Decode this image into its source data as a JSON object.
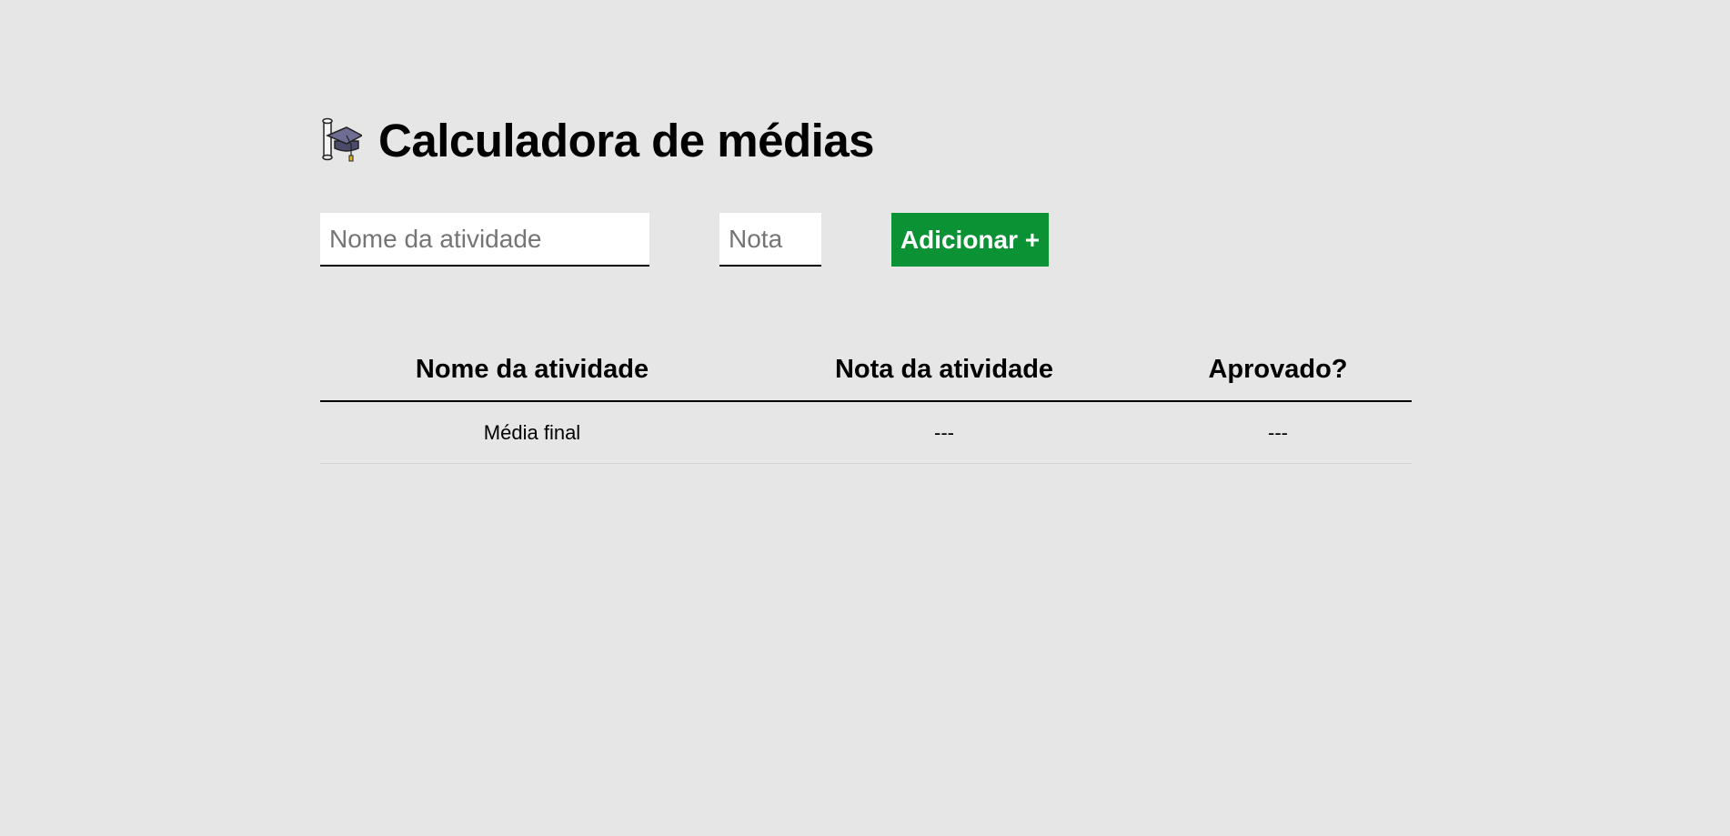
{
  "header": {
    "title": "Calculadora de médias",
    "icon": "graduation-cap-icon"
  },
  "form": {
    "activity_name_placeholder": "Nome da atividade",
    "activity_name_value": "",
    "grade_placeholder": "Nota",
    "grade_value": "",
    "add_label": "Adicionar +",
    "add_color": "#0a9234"
  },
  "table": {
    "headers": [
      "Nome da atividade",
      "Nota da atividade",
      "Aprovado?"
    ],
    "footer_row": [
      "Média final",
      "---",
      "---"
    ]
  },
  "colors": {
    "background": "#e6e6e6",
    "text": "#000000"
  }
}
